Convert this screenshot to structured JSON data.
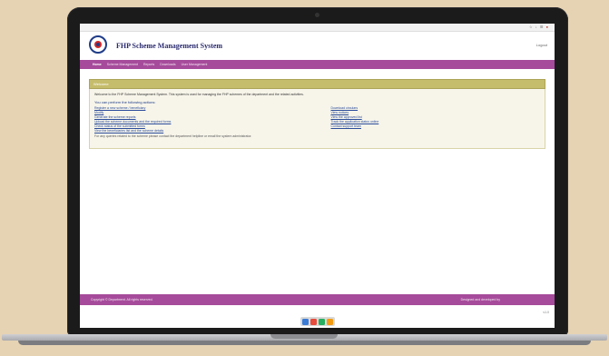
{
  "browser": {
    "tab_title": "",
    "toolbar_icons": "☆ ↓ ☰"
  },
  "site": {
    "title": "FHP Scheme Management System",
    "user": "Logout"
  },
  "nav": {
    "items": [
      {
        "label": "Home"
      },
      {
        "label": "Scheme Management"
      },
      {
        "label": "Reports"
      },
      {
        "label": "Downloads"
      },
      {
        "label": "User Management"
      }
    ]
  },
  "panel": {
    "title": "Welcome",
    "intro": "Welcome to the FHP Scheme Management System. This system is used for managing the FHP schemes of the department and the related activities.",
    "subheading": "You can perform the following actions:",
    "left_links": [
      "Register a new scheme / beneficiary",
      "Modify",
      "Generate the scheme reports",
      "Upload the scheme documents and the required forms",
      "Check status of the submitted forms",
      "View the beneficiaries list and the scheme details"
    ],
    "right_links": [
      "Download circulars",
      "View notices",
      "View the approved list",
      "Track the application status online",
      "Contact support team"
    ],
    "note": "For any queries related to the scheme please contact the department helpline or email the system administrator."
  },
  "footer": {
    "left": "Copyright © Department. All rights reserved.",
    "right": "Designed and developed by"
  },
  "version": "v1.0",
  "colors": {
    "nav_bg": "#a64b9b",
    "panel_head": "#c6bd6c",
    "title": "#2a2a6e"
  }
}
